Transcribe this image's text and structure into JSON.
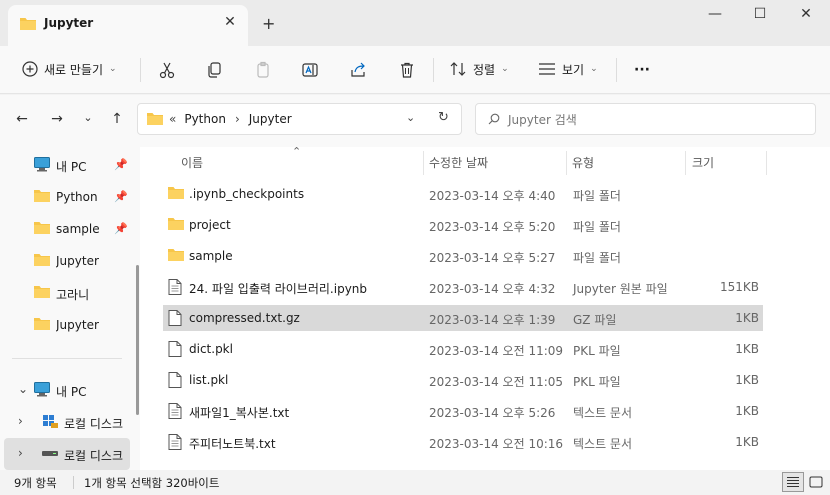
{
  "window": {
    "tab_title": "Jupyter",
    "close_tab": "✕",
    "new_tab": "+",
    "minimize": "—",
    "maximize": "☐",
    "close": "✕"
  },
  "toolbar": {
    "new_label": "새로 만들기",
    "sort_label": "정렬",
    "view_label": "보기",
    "more": "···"
  },
  "address": {
    "prefix": "«",
    "crumbs": [
      "Python",
      "Jupyter"
    ],
    "sep": "›",
    "search_placeholder": "Jupyter 검색"
  },
  "sidebar": {
    "quick": [
      {
        "label": "내 PC",
        "icon": "pc-icon",
        "pinned": true
      },
      {
        "label": "Python",
        "icon": "folder-icon",
        "pinned": true
      },
      {
        "label": "sample",
        "icon": "folder-icon",
        "pinned": true
      },
      {
        "label": "Jupyter",
        "icon": "folder-icon",
        "pinned": false
      },
      {
        "label": "고라니",
        "icon": "folder-icon",
        "pinned": false
      },
      {
        "label": "Jupyter",
        "icon": "folder-icon",
        "pinned": false
      }
    ],
    "tree": [
      {
        "label": "내 PC",
        "icon": "pc-icon",
        "expanded": true
      },
      {
        "label": "로컬 디스크",
        "icon": "windows-drive-icon",
        "expanded": false
      },
      {
        "label": "로컬 디스크",
        "icon": "drive-icon",
        "expanded": false
      }
    ]
  },
  "columns": {
    "name": "이름",
    "date": "수정한 날짜",
    "type": "유형",
    "size": "크기"
  },
  "files": [
    {
      "name": ".ipynb_checkpoints",
      "date": "2023-03-14 오후 4:40",
      "type": "파일 폴더",
      "size": "",
      "kind": "folder"
    },
    {
      "name": "project",
      "date": "2023-03-14 오후 5:20",
      "type": "파일 폴더",
      "size": "",
      "kind": "folder"
    },
    {
      "name": "sample",
      "date": "2023-03-14 오후 5:27",
      "type": "파일 폴더",
      "size": "",
      "kind": "folder"
    },
    {
      "name": "24. 파일 입출력 라이브러리.ipynb",
      "date": "2023-03-14 오후 4:32",
      "type": "Jupyter 원본 파일",
      "size": "151KB",
      "kind": "doc"
    },
    {
      "name": "compressed.txt.gz",
      "date": "2023-03-14 오후 1:39",
      "type": "GZ 파일",
      "size": "1KB",
      "kind": "file"
    },
    {
      "name": "dict.pkl",
      "date": "2023-03-14 오전 11:09",
      "type": "PKL 파일",
      "size": "1KB",
      "kind": "file"
    },
    {
      "name": "list.pkl",
      "date": "2023-03-14 오전 11:05",
      "type": "PKL 파일",
      "size": "1KB",
      "kind": "file"
    },
    {
      "name": "새파일1_복사본.txt",
      "date": "2023-03-14 오후 5:26",
      "type": "텍스트 문서",
      "size": "1KB",
      "kind": "doc"
    },
    {
      "name": "주피터노트북.txt",
      "date": "2023-03-14 오전 10:16",
      "type": "텍스트 문서",
      "size": "1KB",
      "kind": "doc"
    }
  ],
  "selected_row": 4,
  "status": {
    "count": "9개 항목",
    "selection": "1개 항목 선택함 320바이트"
  },
  "colors": {
    "folder": "#f7c64a",
    "selection": "#d9d9d9",
    "accent": "#0067c0"
  }
}
